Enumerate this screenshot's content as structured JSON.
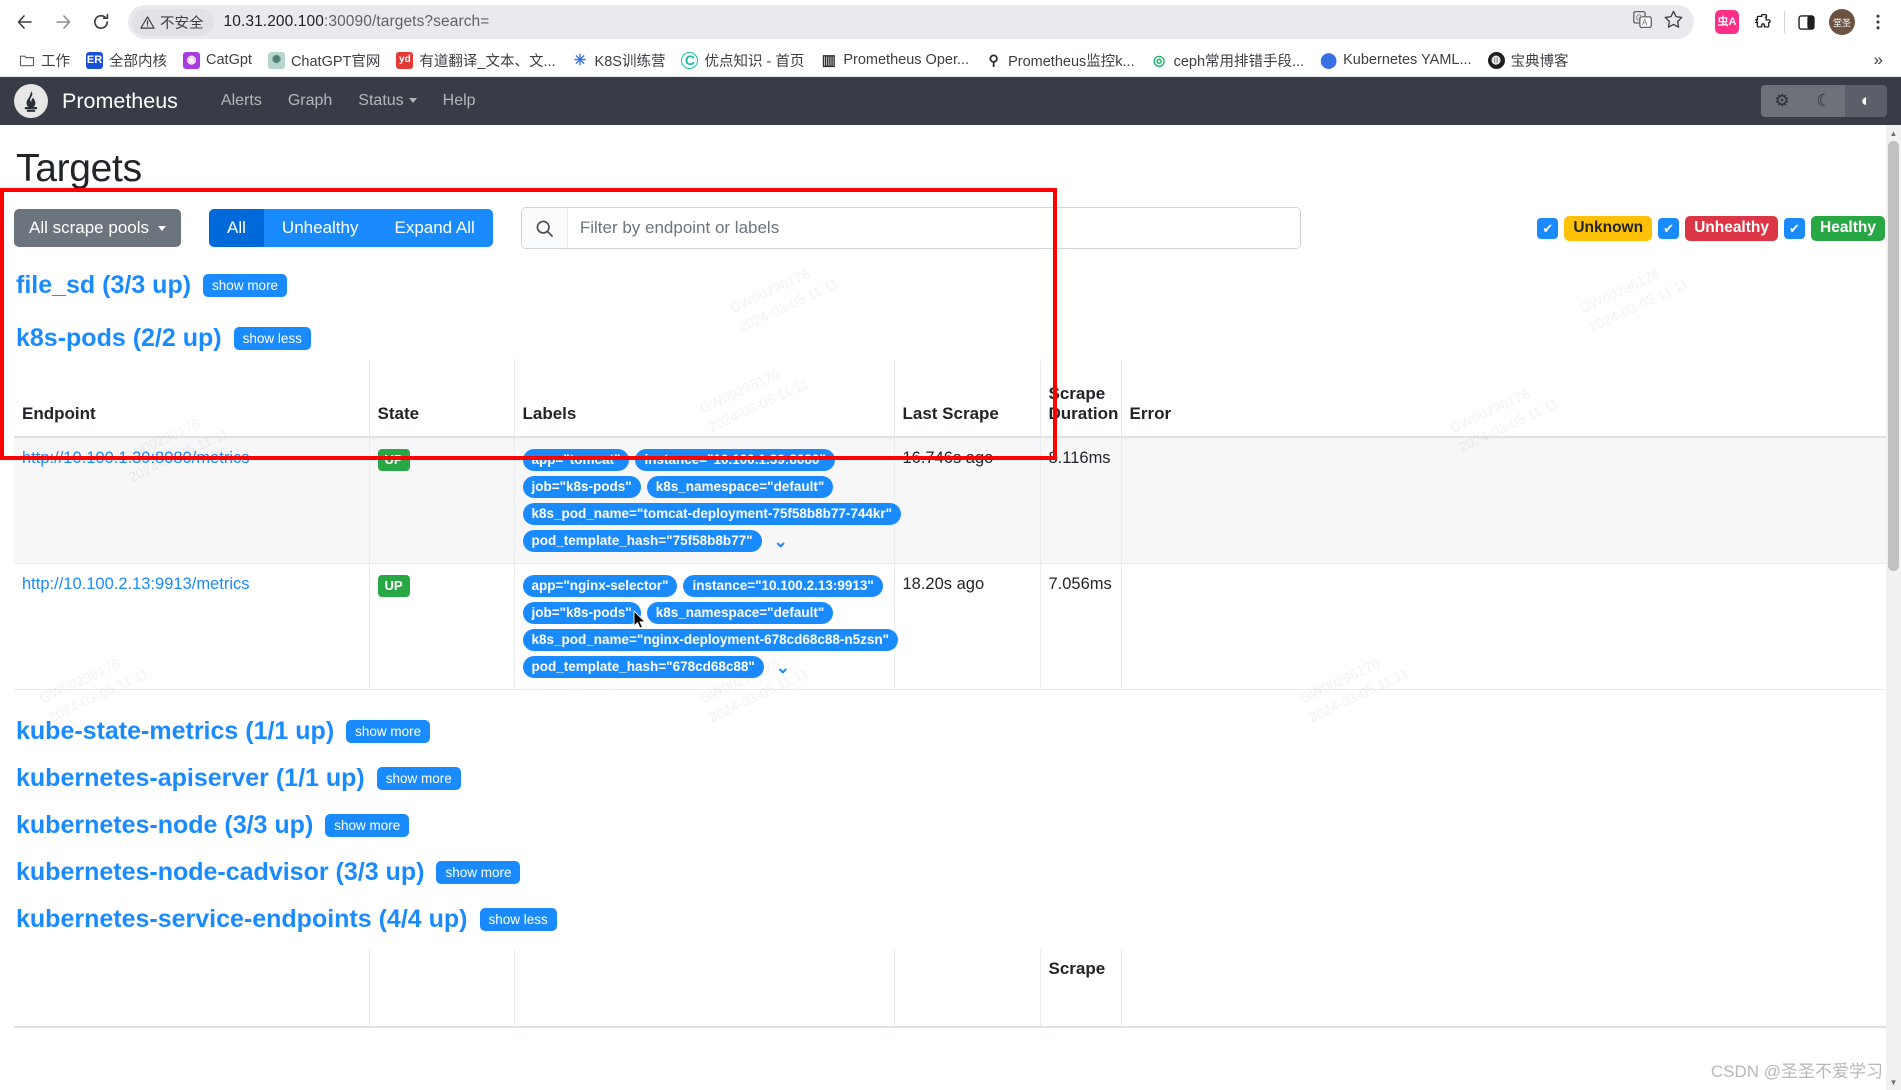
{
  "browser": {
    "nav": {
      "back": "←",
      "forward": "→",
      "reload": "⟳"
    },
    "security_label": "不安全",
    "url_host": "10.31.200.100",
    "url_rest": ":30090/targets?search=",
    "bookmarks": [
      {
        "label": "工作",
        "icon": "folder-icon",
        "color": "#ffffff",
        "text": ""
      },
      {
        "label": "全部内核",
        "icon": "er-icon",
        "color": "#1a4fd6",
        "text": "ER"
      },
      {
        "label": "CatGpt",
        "icon": "catgpt-icon",
        "color": "#a83ce0",
        "text": "◉"
      },
      {
        "label": "ChatGPT官网",
        "icon": "chatgpt-icon",
        "color": "#74aa9c",
        "text": "✺"
      },
      {
        "label": "有道翻译_文本、文...",
        "icon": "youdao-icon",
        "color": "#e53935",
        "text": "yd"
      },
      {
        "label": "K8S训练营",
        "icon": "k8s-training-icon",
        "color": "#3970e4",
        "text": "✳"
      },
      {
        "label": "优点知识 - 首页",
        "icon": "youdian-icon",
        "color": "#1bbfa0",
        "text": "C"
      },
      {
        "label": "Prometheus Oper...",
        "icon": "book-icon",
        "color": "#3d3d3d",
        "text": "▥"
      },
      {
        "label": "Prometheus监控k...",
        "icon": "magnifier-icon",
        "color": "#3d3d3d",
        "text": "⚲"
      },
      {
        "label": "ceph常用排错手段...",
        "icon": "ceph-icon",
        "color": "#17b26a",
        "text": "◎"
      },
      {
        "label": "Kubernetes YAML...",
        "icon": "octopus-icon",
        "color": "#3970e4",
        "text": "✦"
      },
      {
        "label": "宝典博客",
        "icon": "globe-icon",
        "color": "#1f1f1f",
        "text": "◍"
      }
    ],
    "overflow": "»"
  },
  "prometheus_nav": {
    "brand": "Prometheus",
    "links": [
      {
        "label": "Alerts",
        "has_caret": false
      },
      {
        "label": "Graph",
        "has_caret": false
      },
      {
        "label": "Status",
        "has_caret": true
      },
      {
        "label": "Help",
        "has_caret": false
      }
    ],
    "theme_buttons": [
      {
        "name": "gear-icon",
        "glyph": "⚙",
        "active": false
      },
      {
        "name": "moon-icon",
        "glyph": "☾",
        "active": false
      },
      {
        "name": "contrast-icon",
        "glyph": "◐",
        "active": true
      }
    ]
  },
  "page": {
    "title": "Targets",
    "pool_select_label": "All scrape pools",
    "view_buttons": [
      {
        "label": "All",
        "active": true
      },
      {
        "label": "Unhealthy",
        "active": false
      },
      {
        "label": "Expand All",
        "active": false
      }
    ],
    "search": {
      "placeholder": "Filter by endpoint or labels",
      "value": "",
      "icon": "search-icon"
    },
    "state_filters": [
      {
        "label": "Unknown",
        "checked": true,
        "bg": "#ffc107",
        "fg": "#212529"
      },
      {
        "label": "Unhealthy",
        "checked": true,
        "bg": "#dc3545",
        "fg": "#ffffff"
      },
      {
        "label": "Healthy",
        "checked": true,
        "bg": "#28a745",
        "fg": "#ffffff"
      }
    ]
  },
  "pools": [
    {
      "name": "file_sd (3/3 up)",
      "toggle": "show more",
      "expanded": false
    },
    {
      "name": "k8s-pods (2/2 up)",
      "toggle": "show less",
      "expanded": true
    },
    {
      "name": "kube-state-metrics (1/1 up)",
      "toggle": "show more",
      "expanded": false
    },
    {
      "name": "kubernetes-apiserver (1/1 up)",
      "toggle": "show more",
      "expanded": false
    },
    {
      "name": "kubernetes-node (3/3 up)",
      "toggle": "show more",
      "expanded": false
    },
    {
      "name": "kubernetes-node-cadvisor (3/3 up)",
      "toggle": "show more",
      "expanded": false
    },
    {
      "name": "kubernetes-service-endpoints (4/4 up)",
      "toggle": "show less",
      "expanded": true
    }
  ],
  "table": {
    "headers": [
      "Endpoint",
      "State",
      "Labels",
      "Last Scrape",
      "Scrape Duration",
      "Error"
    ],
    "rows": [
      {
        "endpoint": "http://10.100.1.39:8080/metrics",
        "state": "UP",
        "labels": [
          "app=\"tomcat\"",
          "instance=\"10.100.1.39:8080\"",
          "job=\"k8s-pods\"",
          "k8s_namespace=\"default\"",
          "k8s_pod_name=\"tomcat-deployment-75f58b8b77-744kr\"",
          "pod_template_hash=\"75f58b8b77\""
        ],
        "last_scrape": "16.746s ago",
        "scrape_duration": "8.116ms",
        "error": ""
      },
      {
        "endpoint": "http://10.100.2.13:9913/metrics",
        "state": "UP",
        "labels": [
          "app=\"nginx-selector\"",
          "instance=\"10.100.2.13:9913\"",
          "job=\"k8s-pods\"",
          "k8s_namespace=\"default\"",
          "k8s_pod_name=\"nginx-deployment-678cd68c88-n5zsn\"",
          "pod_template_hash=\"678cd68c88\""
        ],
        "last_scrape": "18.20s ago",
        "scrape_duration": "7.056ms",
        "error": ""
      }
    ],
    "expand_chevron": "⌄"
  },
  "bottom_table": {
    "partial_header": "Scrape"
  },
  "watermark": {
    "text_lines": [
      "GW00296176",
      "2024-03-05 11:11"
    ],
    "csdn": "CSDN @圣圣不爱学习"
  },
  "colors": {
    "accent_blue": "#1a8bff",
    "nav_dark": "#373c47",
    "green": "#28a745",
    "red": "#dc3545",
    "yellow": "#ffc107",
    "annotation_red": "#ff0000"
  }
}
